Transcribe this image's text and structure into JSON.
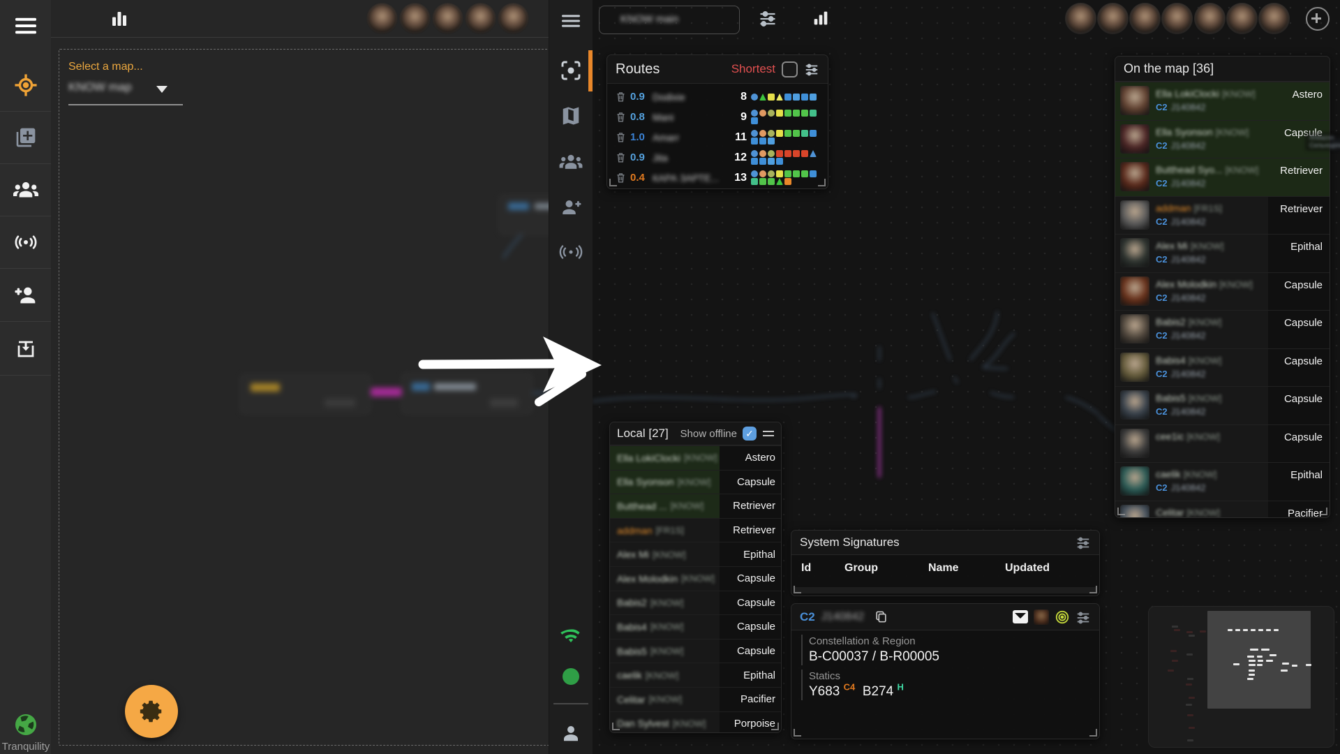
{
  "server": {
    "name": "Tranquility"
  },
  "map_picker": {
    "label": "Select a map...",
    "value": "KNOW map"
  },
  "left_header": {
    "avatar_count": 5
  },
  "toolbar": {
    "map_name": "KNOW main",
    "avatar_count": 7
  },
  "routes": {
    "title": "Routes",
    "shortest_label": "Shortest",
    "shortest_checked": false,
    "rows": [
      {
        "security": "0.9",
        "sec_color": "#54a0dc",
        "name": "Dodixie",
        "jumps": "8",
        "chips": [
          [
            "circle",
            "#4f93d6"
          ],
          [
            "triangle",
            "#3ec43e"
          ],
          [
            "square",
            "#e6df4a"
          ],
          [
            "triangle",
            "#eceb66"
          ],
          [
            "square",
            "#3f8fd8"
          ],
          [
            "square",
            "#4f9fe0"
          ],
          [
            "square",
            "#3f8fd8"
          ],
          [
            "square",
            "#4f9fe0"
          ]
        ]
      },
      {
        "security": "0.8",
        "sec_color": "#54a0dc",
        "name": "Mani",
        "jumps": "9",
        "chips": [
          [
            "circle",
            "#4f93d6"
          ],
          [
            "circle",
            "#e09a62"
          ],
          [
            "circle",
            "#a9b35c"
          ],
          [
            "square",
            "#e6df4a"
          ],
          [
            "square",
            "#52c44a"
          ],
          [
            "square",
            "#52c44a"
          ],
          [
            "square",
            "#52c44a"
          ],
          [
            "square",
            "#43c08a"
          ],
          [
            "square",
            "#3f8fd8"
          ]
        ]
      },
      {
        "security": "1.0",
        "sec_color": "#3b82d4",
        "name": "Amarr",
        "jumps": "11",
        "chips": [
          [
            "circle",
            "#4f93d6"
          ],
          [
            "circle",
            "#e09a62"
          ],
          [
            "circle",
            "#a9b35c"
          ],
          [
            "square",
            "#e6df4a"
          ],
          [
            "square",
            "#52c44a"
          ],
          [
            "square",
            "#52c44a"
          ],
          [
            "square",
            "#43c08a"
          ],
          [
            "square",
            "#3f8fd8"
          ],
          [
            "square",
            "#3f8fd8"
          ],
          [
            "square",
            "#3f8fd8"
          ],
          [
            "square",
            "#4f9fe0"
          ]
        ]
      },
      {
        "security": "0.9",
        "sec_color": "#54a0dc",
        "name": "Jita",
        "jumps": "12",
        "chips": [
          [
            "circle",
            "#4f93d6"
          ],
          [
            "circle",
            "#e09a62"
          ],
          [
            "circle",
            "#a9b35c"
          ],
          [
            "square",
            "#d8452a"
          ],
          [
            "square",
            "#d8452a"
          ],
          [
            "square",
            "#d8452a"
          ],
          [
            "square",
            "#d8452a"
          ],
          [
            "triangle",
            "#4f93d6"
          ],
          [
            "square",
            "#3f8fd8"
          ],
          [
            "square",
            "#3f8fd8"
          ],
          [
            "square",
            "#4f9fe0"
          ],
          [
            "square",
            "#3f8fd8"
          ]
        ]
      },
      {
        "security": "0.4",
        "sec_color": "#e0791f",
        "name": "КАРА ЗАРТЕ...",
        "jumps": "13",
        "chips": [
          [
            "circle",
            "#4f93d6"
          ],
          [
            "circle",
            "#e09a62"
          ],
          [
            "circle",
            "#a9b35c"
          ],
          [
            "square",
            "#e6df4a"
          ],
          [
            "square",
            "#52c44a"
          ],
          [
            "square",
            "#52c44a"
          ],
          [
            "square",
            "#52c44a"
          ],
          [
            "square",
            "#3f8fd8"
          ],
          [
            "square",
            "#43c08a"
          ],
          [
            "square",
            "#52c44a"
          ],
          [
            "square",
            "#52c44a"
          ],
          [
            "triangle",
            "#3ec43e"
          ],
          [
            "square",
            "#e8872a"
          ]
        ]
      }
    ]
  },
  "local": {
    "title": "Local [27]",
    "show_offline_label": "Show offline",
    "show_offline_checked": true,
    "rows": [
      {
        "name": "Ella LokiClocki",
        "tag": "[KNOW]",
        "ship": "Astero",
        "highlight": true
      },
      {
        "name": "Ella Syonson",
        "tag": "[KNOW]",
        "ship": "Capsule",
        "highlight": true
      },
      {
        "name": "Butthead ...",
        "tag": "[KNOW]",
        "ship": "Retriever",
        "highlight": true
      },
      {
        "name": "addman",
        "tag": "[FR1S]",
        "ship": "Retriever",
        "name_color": "#e08a2a"
      },
      {
        "name": "Alex Mi",
        "tag": "[KNOW]",
        "ship": "Epithal"
      },
      {
        "name": "Alex Molodkin",
        "tag": "[KNOW]",
        "ship": "Capsule"
      },
      {
        "name": "Babis2",
        "tag": "[KNOW]",
        "ship": "Capsule"
      },
      {
        "name": "Babis4",
        "tag": "[KNOW]",
        "ship": "Capsule"
      },
      {
        "name": "Babis5",
        "tag": "[KNOW]",
        "ship": "Capsule"
      },
      {
        "name": "caelik",
        "tag": "[KNOW]",
        "ship": "Epithal"
      },
      {
        "name": "Celitar",
        "tag": "[KNOW]",
        "ship": "Pacifier"
      },
      {
        "name": "Dan Sylvest",
        "tag": "[KNOW]",
        "ship": "Porpoise"
      }
    ]
  },
  "on_map": {
    "title": "On the map [36]",
    "rows": [
      {
        "name": "Ella LokiClocki",
        "tag": "[KNOW]",
        "ship": "Astero",
        "wh_class": "C2",
        "system": "J140842",
        "highlight": true,
        "avatar_color": "#5f4030"
      },
      {
        "name": "Ella Syonson",
        "tag": "[KNOW]",
        "ship": "Capsule",
        "wh_class": "C2",
        "system": "J140842",
        "highlight": true,
        "avatar_color": "#4a2424"
      },
      {
        "name": "Butthead Syo...",
        "tag": "[KNOW]",
        "ship": "Retriever",
        "wh_class": "C2",
        "system": "J140842",
        "highlight": true,
        "avatar_color": "#58281a"
      },
      {
        "name": "addman",
        "tag": "[FR1S]",
        "ship": "Retriever",
        "wh_class": "C2",
        "system": "J140842",
        "name_color": "#e08a2a",
        "avatar_color": "#5a5a5a"
      },
      {
        "name": "Alex Mi",
        "tag": "[KNOW]",
        "ship": "Epithal",
        "wh_class": "C2",
        "system": "J140842",
        "avatar_color": "#2e3430"
      },
      {
        "name": "Alex Molodkin",
        "tag": "[KNOW]",
        "ship": "Capsule",
        "wh_class": "C2",
        "system": "J140842",
        "avatar_color": "#66301a"
      },
      {
        "name": "Babis2",
        "tag": "[KNOW]",
        "ship": "Capsule",
        "wh_class": "C2",
        "system": "J140842",
        "avatar_color": "#4f463c"
      },
      {
        "name": "Babis4",
        "tag": "[KNOW]",
        "ship": "Capsule",
        "wh_class": "C2",
        "system": "J140842",
        "avatar_color": "#635a3a"
      },
      {
        "name": "Babis5",
        "tag": "[KNOW]",
        "ship": "Capsule",
        "wh_class": "C2",
        "system": "J140842",
        "avatar_color": "#39424c"
      },
      {
        "name": "cee1ic",
        "tag": "[KNOW]",
        "ship": "Capsule",
        "avatar_color": "#3c3c3c"
      },
      {
        "name": "caelik",
        "tag": "[KNOW]",
        "ship": "Epithal",
        "wh_class": "C2",
        "system": "J140842",
        "avatar_color": "#2a5a55"
      },
      {
        "name": "Celitar",
        "tag": "[KNOW]",
        "ship": "Pacifier",
        "avatar_color": "#44505c"
      }
    ]
  },
  "signatures": {
    "title": "System Signatures",
    "columns": [
      "Id",
      "Group",
      "Name",
      "Updated"
    ]
  },
  "system_info": {
    "wh_class": "C2",
    "system_name": "J140842",
    "constellation_label": "Constellation & Region",
    "constellation_value": "B-C00037 / B-R00005",
    "statics_label": "Statics",
    "statics": [
      {
        "code": "Y683",
        "type": "C4",
        "type_color": "#e0791f"
      },
      {
        "code": "B274",
        "type": "H",
        "type_color": "#3fd9a4"
      }
    ]
  },
  "map_overlay": {
    "tooltip_line1": "Ahbazon",
    "tooltip_line2": "Сильнодпномчик"
  },
  "colors": {
    "accent_orange": "#f5a845",
    "active_bar": "#e8872a",
    "highlight_row": "#1c2916",
    "shortest_red": "#e25050",
    "class_blue": "#4a90d9",
    "online_green": "#2f9e46"
  }
}
